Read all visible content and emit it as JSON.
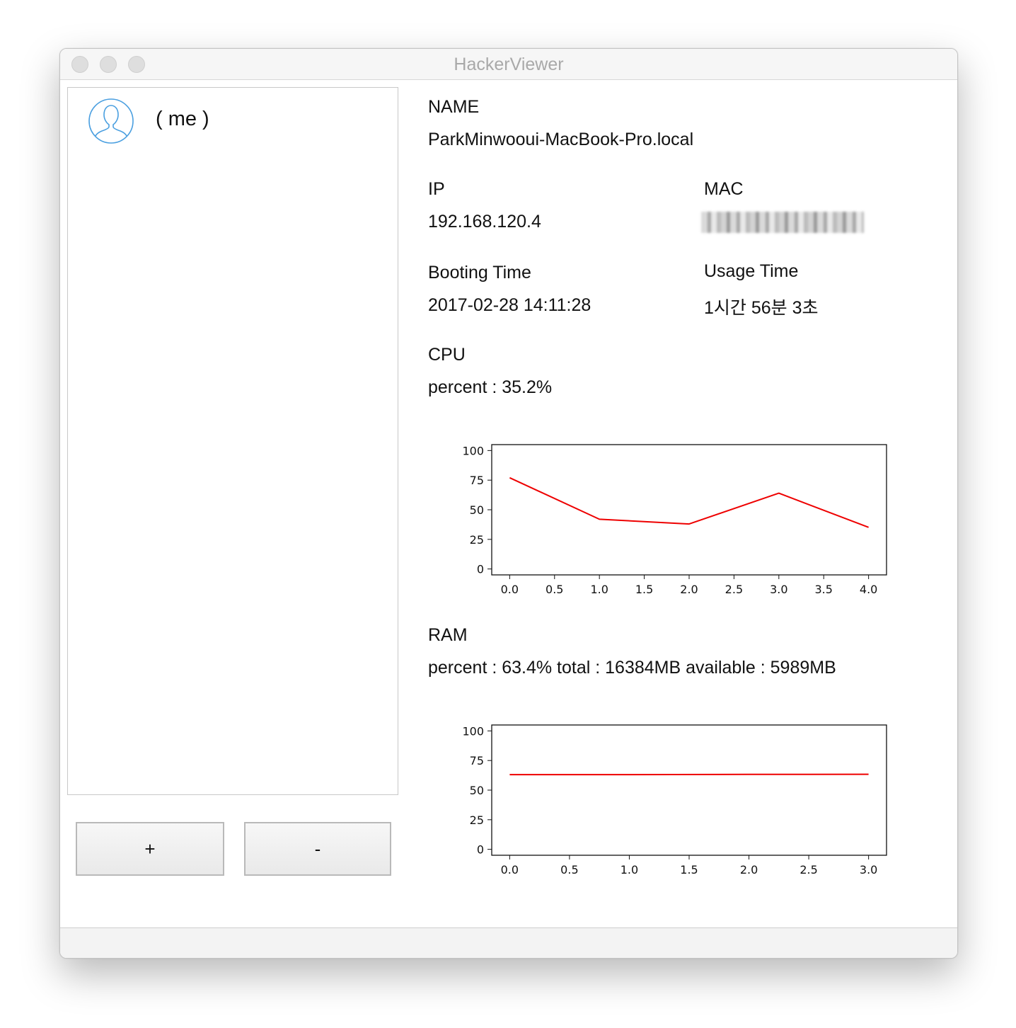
{
  "window": {
    "title": "HackerViewer"
  },
  "sidebar": {
    "items": [
      {
        "label": "( me )"
      }
    ],
    "add_label": "+",
    "remove_label": "-"
  },
  "details": {
    "name_heading": "NAME",
    "name_value": "ParkMinwooui-MacBook-Pro.local",
    "ip_heading": "IP",
    "ip_value": "192.168.120.4",
    "mac_heading": "MAC",
    "booting_heading": "Booting Time",
    "booting_value": "2017-02-28 14:11:28",
    "usage_heading": "Usage Time",
    "usage_value": "1시간 56분 3초",
    "cpu_heading": "CPU",
    "cpu_value": "percent : 35.2%",
    "ram_heading": "RAM",
    "ram_value": "percent : 63.4%  total : 16384MB  available : 5989MB"
  },
  "colors": {
    "line": "#ee0000",
    "avatar": "#4a9fe0"
  },
  "chart_data": [
    {
      "id": "cpu",
      "type": "line",
      "x": [
        0,
        1,
        2,
        3,
        4
      ],
      "series": [
        {
          "values": [
            77,
            42,
            38,
            64,
            35.2
          ]
        }
      ],
      "xticks": [
        "0.0",
        "0.5",
        "1.0",
        "1.5",
        "2.0",
        "2.5",
        "3.0",
        "3.5",
        "4.0"
      ],
      "xlim": [
        -0.2,
        4.2
      ],
      "yticks": [
        "0",
        "25",
        "50",
        "75",
        "100"
      ],
      "ylim": [
        -5,
        105
      ]
    },
    {
      "id": "ram",
      "type": "line",
      "x": [
        0,
        1,
        2,
        3
      ],
      "series": [
        {
          "values": [
            63.1,
            63.1,
            63.3,
            63.4
          ]
        }
      ],
      "xticks": [
        "0.0",
        "0.5",
        "1.0",
        "1.5",
        "2.0",
        "2.5",
        "3.0"
      ],
      "xlim": [
        -0.15,
        3.15
      ],
      "yticks": [
        "0",
        "25",
        "50",
        "75",
        "100"
      ],
      "ylim": [
        -5,
        105
      ]
    }
  ]
}
